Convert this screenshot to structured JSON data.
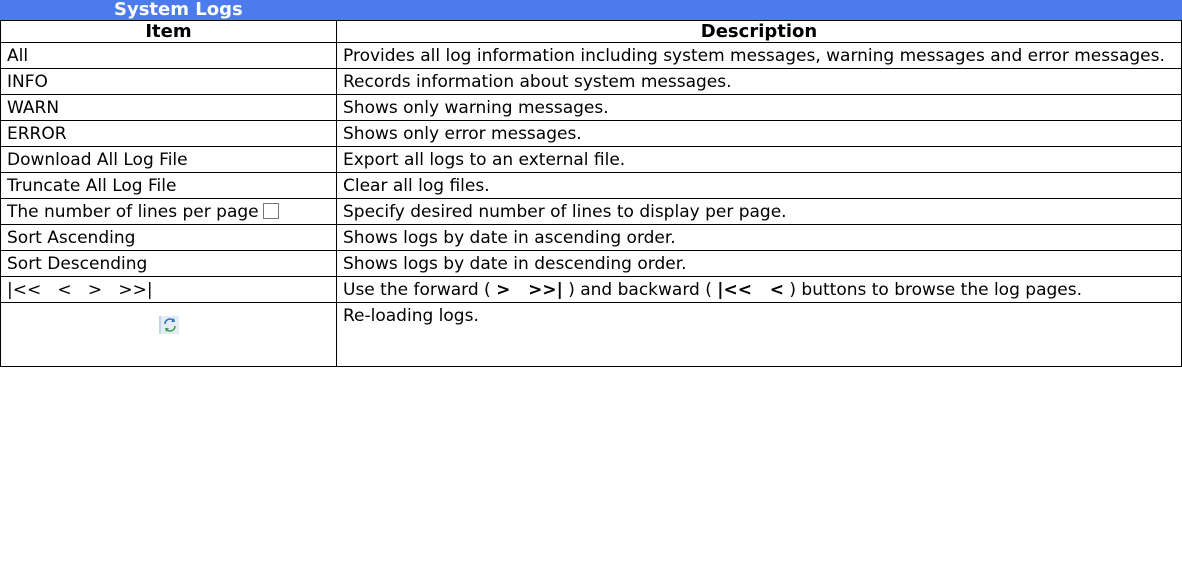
{
  "header": {
    "title": "System Logs"
  },
  "table": {
    "columns": [
      "Item",
      "Description"
    ],
    "rows": [
      {
        "item": "All",
        "description": "Provides all log information including system messages, warning messages and error messages."
      },
      {
        "item": "INFO",
        "description": "Records information about system messages."
      },
      {
        "item": "WARN",
        "description": "Shows only warning messages."
      },
      {
        "item": "ERROR",
        "description": "Shows only error messages."
      },
      {
        "item": "Download All Log File",
        "description": "Export all logs to an external file."
      },
      {
        "item": "Truncate All Log File",
        "description": "Clear all log files."
      },
      {
        "item": "The number of lines per page",
        "description": "Specify desired number of lines to display per page."
      },
      {
        "item": "Sort Ascending",
        "description": "Shows logs by date in ascending order."
      },
      {
        "item": "Sort Descending",
        "description": "Shows logs by date in descending order."
      },
      {
        "item": "|<<   <   >   >>|",
        "description_parts": {
          "pre": "Use the forward ( ",
          "forward": ">   >>|",
          "mid": " ) and backward ( ",
          "backward": "|<<   <",
          "post": " )   buttons to browse the log pages."
        }
      },
      {
        "item_icon": "refresh-icon",
        "description": "Re-loading logs."
      }
    ]
  }
}
